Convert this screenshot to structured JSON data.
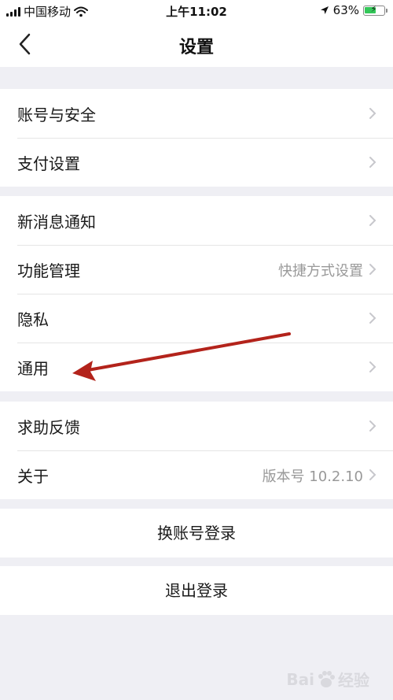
{
  "status_bar": {
    "carrier": "中国移动",
    "time": "上午11:02",
    "battery": "63%",
    "battery_level": 0.63
  },
  "nav": {
    "title": "设置"
  },
  "groups": [
    {
      "rows": [
        {
          "label": "账号与安全",
          "value": ""
        },
        {
          "label": "支付设置",
          "value": ""
        }
      ]
    },
    {
      "rows": [
        {
          "label": "新消息通知",
          "value": ""
        },
        {
          "label": "功能管理",
          "value": "快捷方式设置"
        },
        {
          "label": "隐私",
          "value": ""
        },
        {
          "label": "通用",
          "value": ""
        }
      ]
    },
    {
      "rows": [
        {
          "label": "求助反馈",
          "value": ""
        },
        {
          "label": "关于",
          "value": "版本号 10.2.10"
        }
      ]
    }
  ],
  "actions": {
    "switch_account": "换账号登录",
    "logout": "退出登录"
  },
  "watermark": {
    "logo_text": "Bai",
    "suffix": "经验"
  },
  "icons": {
    "back": "chevron-left-icon",
    "row_chevron": "chevron-right-icon",
    "wifi": "wifi-icon",
    "location": "location-arrow-icon"
  },
  "colors": {
    "background": "#efeff4",
    "battery": "#34c759",
    "annotation_arrow": "#b3231b"
  }
}
